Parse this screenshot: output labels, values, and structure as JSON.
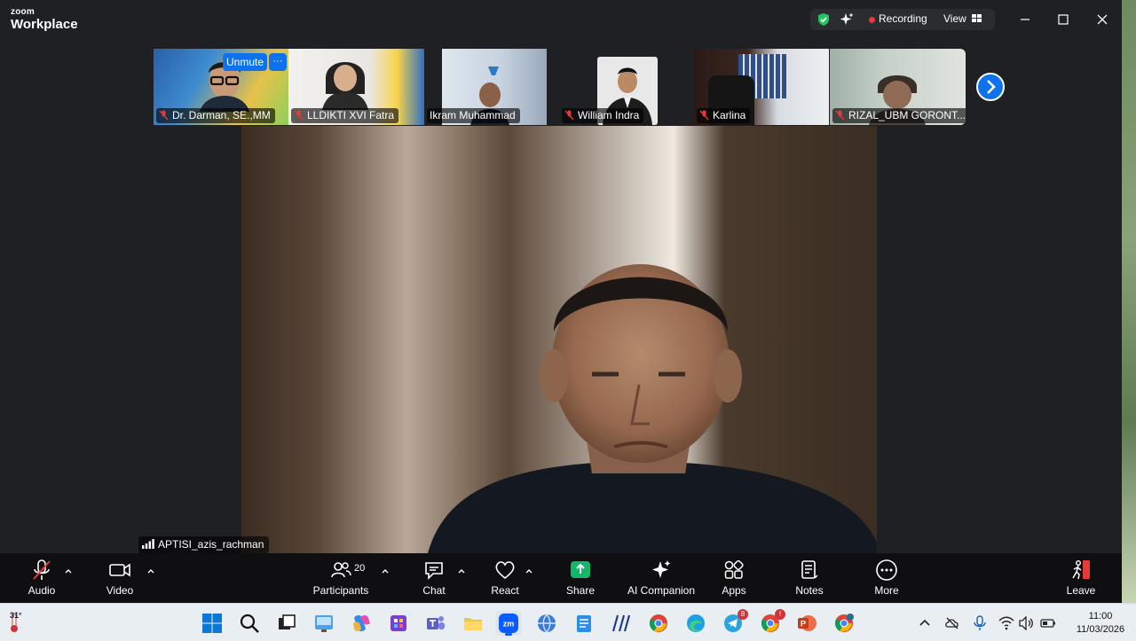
{
  "titlebar": {
    "brand_small": "zoom",
    "brand_main": "Workplace",
    "recording_label": "Recording",
    "view_label": "View"
  },
  "filmstrip": {
    "tiles": [
      {
        "name": "Dr. Darman, SE.,MM",
        "muted": true,
        "unmute_label": "Unmute",
        "more_label": "···"
      },
      {
        "name": "LLDIKTI XVI Fatra",
        "muted": true
      },
      {
        "name": "Ikram Muhammad",
        "muted": false
      },
      {
        "name": "William Indra",
        "muted": true
      },
      {
        "name": "Karlina",
        "muted": true
      },
      {
        "name": "RIZAL_UBM GORONT...",
        "muted": true
      }
    ]
  },
  "main_video": {
    "speaker_name": "APTISI_azis_rachman"
  },
  "toolbar": {
    "audio_label": "Audio",
    "video_label": "Video",
    "participants_label": "Participants",
    "participants_count": "20",
    "chat_label": "Chat",
    "react_label": "React",
    "share_label": "Share",
    "ai_companion_label": "AI Companion",
    "apps_label": "Apps",
    "notes_label": "Notes",
    "more_label": "More",
    "leave_label": "Leave"
  },
  "taskbar": {
    "weather_temp": "31°",
    "time": "11:00",
    "date": "11/03/2026",
    "telegram_badge": "8",
    "chrome_badge": "!"
  },
  "colors": {
    "accent": "#0e72ed",
    "recording": "#e5393a",
    "share": "#12b76a",
    "leave": "#e5393a"
  }
}
